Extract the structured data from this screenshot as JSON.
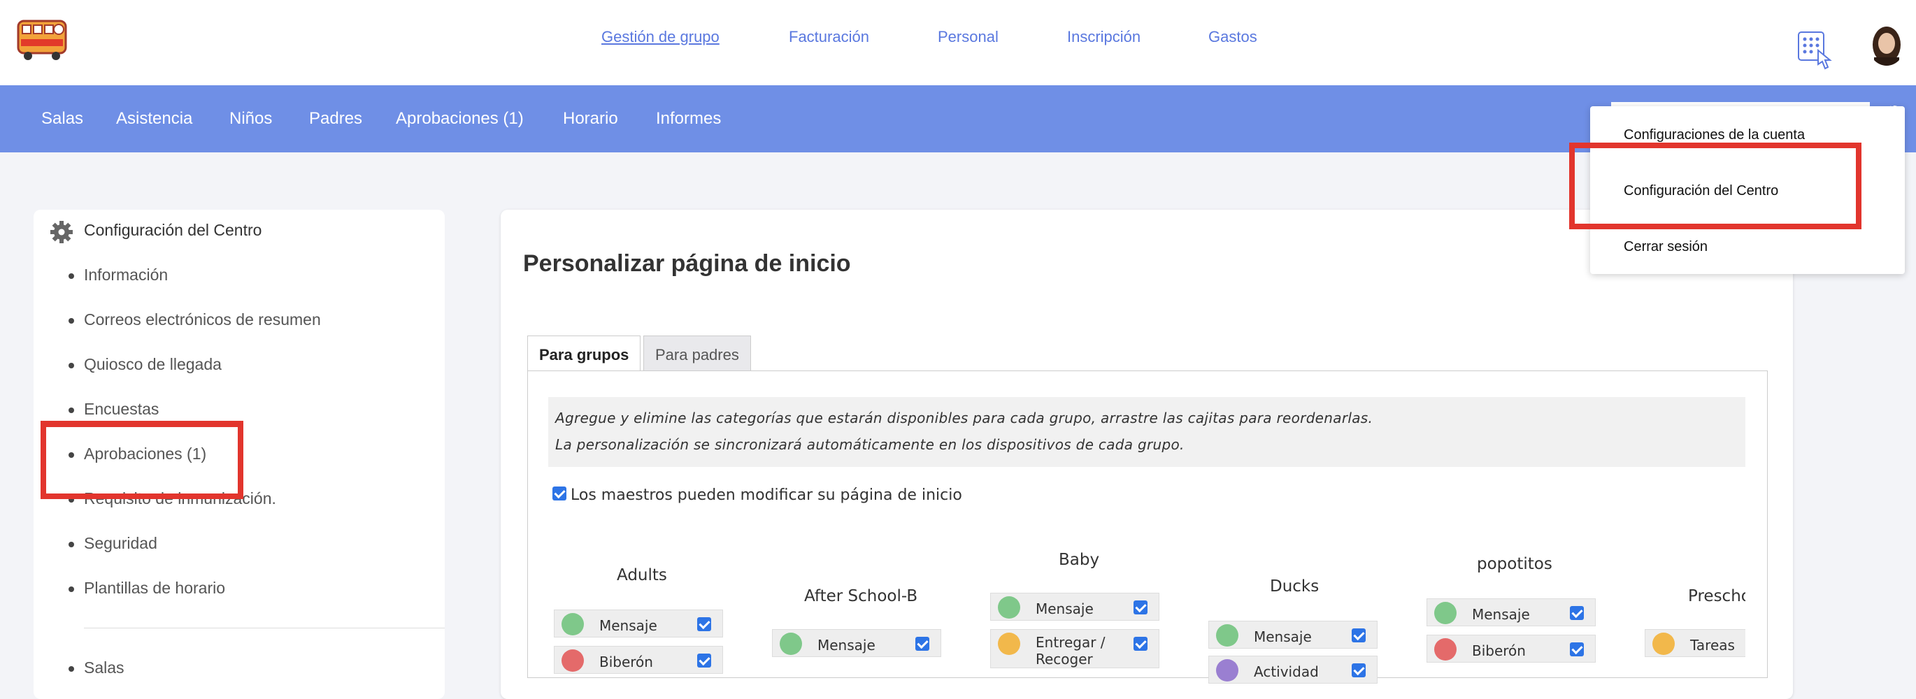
{
  "topnav": [
    "Gestión de grupo",
    "Facturación",
    "Personal",
    "Inscripción",
    "Gastos"
  ],
  "mainnav": [
    "Salas",
    "Asistencia",
    "Niños",
    "Padres",
    "Aprobaciones (1)",
    "Horario",
    "Informes"
  ],
  "dropdown": {
    "account_settings": "Configuraciones de la cuenta",
    "center_settings": "Configuración del Centro",
    "logout": "Cerrar sesión"
  },
  "sidebar": {
    "title": "Configuración del Centro",
    "items": [
      "Información",
      "Correos electrónicos de resumen",
      "Quiosco de llegada",
      "Encuestas",
      "Aprobaciones (1)",
      "Requisito de inmunización.",
      "Seguridad",
      "Plantillas de horario"
    ],
    "bottom_item": "Salas"
  },
  "main": {
    "title": "Personalizar página de inicio",
    "tabs": [
      "Para grupos",
      "Para padres"
    ],
    "info_line1": "Agregue y elimine las categorías que estarán disponibles para cada grupo, arrastre las cajitas para reordenarlas.",
    "info_line2": "La personalización se sincronizará automáticamente en los dispositivos de cada grupo.",
    "teachers_can_modify": "Los maestros pueden modificar su página de inicio",
    "teachers_can_modify_checked": true,
    "groups": [
      {
        "name": "Adults",
        "categories": [
          {
            "label": "Mensaje",
            "icon": "message-icon",
            "color": "#7fc88a"
          },
          {
            "label": "Biberón",
            "icon": "bottle-icon",
            "color": "#e46a6a"
          }
        ]
      },
      {
        "name": "After School-B",
        "categories": [
          {
            "label": "Mensaje",
            "icon": "message-icon",
            "color": "#7fc88a"
          }
        ]
      },
      {
        "name": "Baby",
        "categories": [
          {
            "label": "Mensaje",
            "icon": "message-icon",
            "color": "#7fc88a"
          },
          {
            "label": "Entregar / Recoger",
            "icon": "home-icon",
            "color": "#f2b84b"
          }
        ]
      },
      {
        "name": "Ducks",
        "categories": [
          {
            "label": "Mensaje",
            "icon": "message-icon",
            "color": "#7fc88a"
          },
          {
            "label": "Actividad",
            "icon": "activity-icon",
            "color": "#9a7fd1"
          }
        ]
      },
      {
        "name": "popotitos",
        "categories": [
          {
            "label": "Mensaje",
            "icon": "message-icon",
            "color": "#7fc88a"
          },
          {
            "label": "Biberón",
            "icon": "bottle-icon",
            "color": "#e46a6a"
          }
        ]
      },
      {
        "name": "Prescho",
        "categories": [
          {
            "label": "Tareas",
            "icon": "star-icon",
            "color": "#f2b84b"
          }
        ]
      }
    ]
  },
  "colors": {
    "accent": "#6f8fe6",
    "link": "#5a78df",
    "highlight": "#e2352d",
    "checkbox": "#2d74e6"
  }
}
